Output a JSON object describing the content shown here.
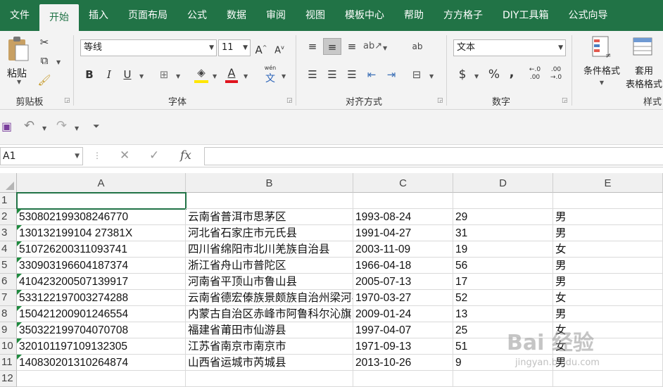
{
  "tabs": [
    "文件",
    "开始",
    "插入",
    "页面布局",
    "公式",
    "数据",
    "审阅",
    "视图",
    "模板中心",
    "帮助",
    "方方格子",
    "DIY工具箱",
    "公式向导"
  ],
  "ribbon": {
    "clipboard": {
      "paste": "粘贴",
      "label": "剪贴板"
    },
    "font": {
      "name": "等线",
      "size": "11",
      "label": "字体",
      "bold": "B",
      "italic": "I",
      "underline": "U",
      "grow": "A",
      "shrink": "A",
      "pinyin": "wén"
    },
    "alignment": {
      "label": "对齐方式",
      "wrap": "ab"
    },
    "number": {
      "format": "文本",
      "label": "数字",
      "currency": "$",
      "percent": "%",
      "comma": ","
    },
    "styles": {
      "conditional": "条件格式",
      "table_line1": "套用",
      "table_line2": "表格格式",
      "label": "样式"
    }
  },
  "formula_bar": {
    "name_box": "A1",
    "fx": "fx",
    "cancel": "✕",
    "enter": "✓",
    "value": ""
  },
  "columns": [
    "A",
    "B",
    "C",
    "D",
    "E"
  ],
  "rows": [
    [
      "",
      "",
      "",
      "",
      ""
    ],
    [
      "530802199308246770",
      "云南省普洱市思茅区",
      "1993-08-24",
      "29",
      "男"
    ],
    [
      "130132199104 27381X",
      "河北省石家庄市元氏县",
      "1991-04-27",
      "31",
      "男"
    ],
    [
      "510726200311093741",
      "四川省绵阳市北川羌族自治县",
      "2003-11-09",
      "19",
      "女"
    ],
    [
      "330903196604187374",
      "浙江省舟山市普陀区",
      "1966-04-18",
      "56",
      "男"
    ],
    [
      "410423200507139917",
      "河南省平顶山市鲁山县",
      "2005-07-13",
      "17",
      "男"
    ],
    [
      "533122197003274288",
      "云南省德宏傣族景颇族自治州梁河县",
      "1970-03-27",
      "52",
      "女"
    ],
    [
      "150421200901246554",
      "内蒙古自治区赤峰市阿鲁科尔沁旗",
      "2009-01-24",
      "13",
      "男"
    ],
    [
      "350322199704070708",
      "福建省莆田市仙游县",
      "1997-04-07",
      "25",
      "女"
    ],
    [
      "320101197109132305",
      "江苏省南京市南京市",
      "1971-09-13",
      "51",
      "女"
    ],
    [
      "140830201310264874",
      "山西省运城市芮城县",
      "2013-10-26",
      "9",
      "男"
    ],
    [
      "",
      "",
      "",
      "",
      ""
    ]
  ],
  "row_numbers": [
    "1",
    "2",
    "3",
    "4",
    "5",
    "6",
    "7",
    "8",
    "9",
    "10",
    "11",
    "12"
  ],
  "watermark": {
    "main": "Bai 经验",
    "sub": "jingyan.baidu.com"
  },
  "colors": {
    "accent": "#217346"
  }
}
